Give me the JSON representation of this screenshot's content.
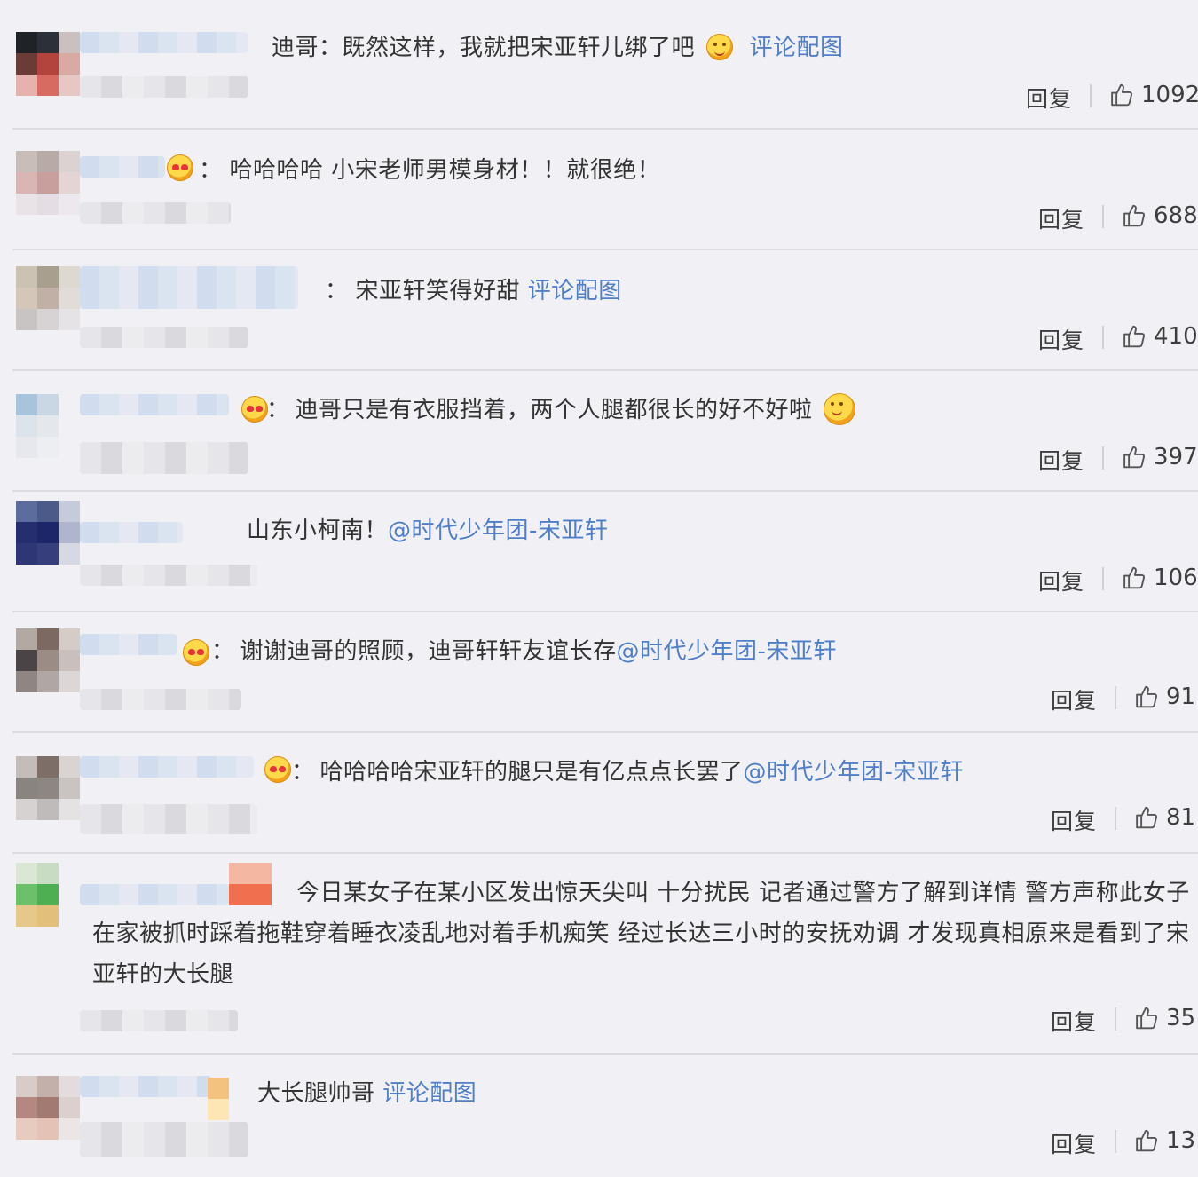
{
  "comments": [
    {
      "colon": "",
      "segments": [
        {
          "text": "迪哥：既然这样，我就把宋亚轩儿绑了吧"
        },
        {
          "text": "评论配图",
          "link": true
        }
      ],
      "reply": "回复",
      "likes": "1092",
      "partial_meta": ""
    },
    {
      "colon": "：",
      "segments": [
        {
          "text": "哈哈哈哈 小宋老师男模身材！！就很绝！"
        }
      ],
      "reply": "回复",
      "likes": "688",
      "partial_meta": "28"
    },
    {
      "colon": "：",
      "segments": [
        {
          "text": "宋亚轩笑得好甜 "
        },
        {
          "text": "评论配图",
          "link": true
        }
      ],
      "reply": "回复",
      "likes": "410",
      "partial_meta": ""
    },
    {
      "colon": "：",
      "segments": [
        {
          "text": "迪哥只是有衣服挡着，两个人腿都很长的好不好啦"
        }
      ],
      "reply": "回复",
      "likes": "397",
      "partial_meta": "2"
    },
    {
      "colon": "",
      "segments": [
        {
          "text": "山东小柯南！"
        },
        {
          "text": "@时代少年团-宋亚轩",
          "link": true
        }
      ],
      "reply": "回复",
      "likes": "106",
      "partial_meta": ""
    },
    {
      "colon": "：",
      "segments": [
        {
          "text": "谢谢迪哥的照顾，迪哥轩轩友谊长存"
        },
        {
          "text": "@时代少年团-宋亚轩",
          "link": true
        }
      ],
      "reply": "回复",
      "likes": "91",
      "partial_meta": "4"
    },
    {
      "colon": "：",
      "segments": [
        {
          "text": "哈哈哈哈宋亚轩的腿只是有亿点点长罢了"
        },
        {
          "text": "@时代少年团-宋亚轩",
          "link": true
        }
      ],
      "reply": "回复",
      "likes": "81",
      "partial_meta": ""
    },
    {
      "colon": "",
      "segments": [
        {
          "text": "今日某女子在某小区发出惊天尖叫 十分扰民 记者通过警方了解到详情 警方声称此女子在家被抓时踩着拖鞋穿着睡衣凌乱地对着手机痴笑 经过长达三小时的安抚劝调 才发现真相原来是看到了宋亚轩的大长腿"
        }
      ],
      "reply": "回复",
      "likes": "35",
      "partial_meta": "4"
    },
    {
      "colon": "",
      "segments": [
        {
          "text": "大长腿帅哥 "
        },
        {
          "text": "评论配图",
          "link": true
        }
      ],
      "reply": "回复",
      "likes": "13",
      "partial_meta": ""
    }
  ],
  "icons": {
    "like": "thumbs-up-icon",
    "emoji": "emoji-icon"
  },
  "colors": {
    "link": "#4f7fc9",
    "background": "#f1f0f4",
    "divider": "#dcdbe0"
  }
}
